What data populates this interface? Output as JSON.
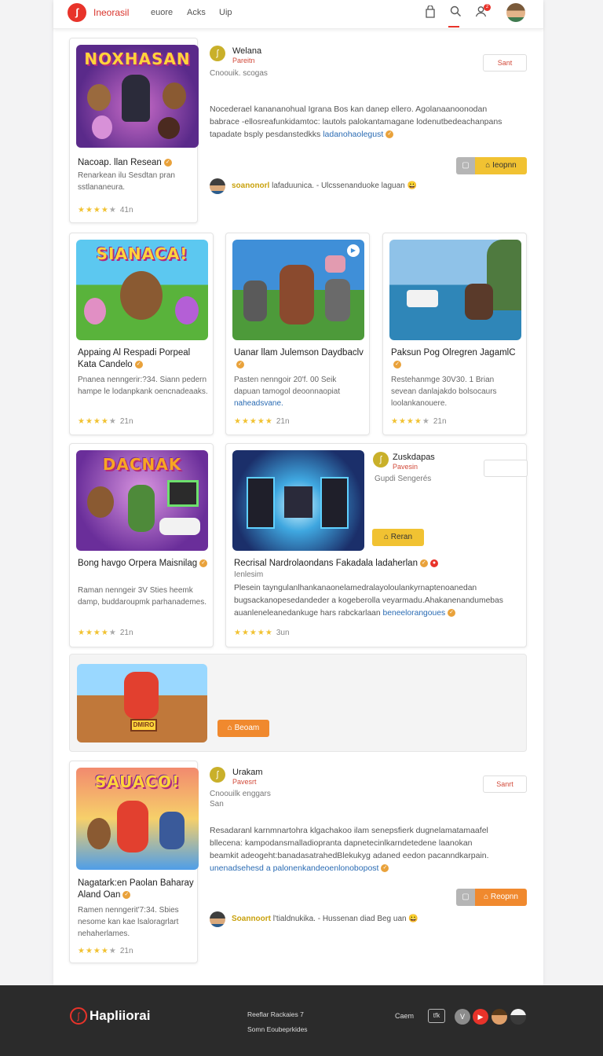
{
  "header": {
    "brand": "Ineorasil",
    "nav": [
      "euore",
      "Acks",
      "Uip"
    ],
    "notification_count": "2"
  },
  "featured": [
    {
      "thumb_text": "NOXHASAN",
      "title": "Nacoap. llan Resean",
      "desc": "Renarkean ilu Sesdtan pran sstlananeura.",
      "rating_count": "41n",
      "org_name": "Welana",
      "org_sub": "Pareitn",
      "org_meta": "Cnoouik. scogas",
      "org_meta2": "",
      "action": "Sant",
      "text_lines": [
        "Nocederael kanananohual Igrana Bos kan danep ellero. Agolanaanoonodan",
        "babrace -ellosreafunkidamtoc: lautols palokantamagane lodenutbedeachanpans",
        "tapadate bsply pesdanstedkks"
      ],
      "text_link": "ladanohaolegust",
      "cta": "Ieopnn",
      "user_name": "soanonorl",
      "user_text": "lafaduunica. - Ulcssenanduoke laguan"
    },
    {
      "thumb_text": "SAUACO!",
      "title": "Nagatark:en Paolan Baharay Aland Oan",
      "desc": "Ramen nenngerit'7:34. Sbies nesome kan kae lsaloragrlart nehaherlames.",
      "rating_count": "21n",
      "org_name": "Urakam",
      "org_sub": "Pavesrt",
      "org_meta": "Cnoouilk enggars",
      "org_meta2": "San",
      "action": "Sanrt",
      "text_lines": [
        "Resadaranl karnmnartohra klgachakoo ilam senepsfierk dugnelamatamaafel",
        "bllecena: kampodansmalladiopranta dapnetecinlkarndetedene laanokan",
        "beamkit adeogeht:banadasatrahedBlekukyg adaned eedon pacanndkarpain."
      ],
      "text_link": "unenadsehesd a palonenkandeoenlonobopost",
      "cta": "Reopnn",
      "user_name": "Soannoort",
      "user_text": "l'tialdnukika. - Hussenan diad Beg uan"
    }
  ],
  "grid": [
    {
      "thumb_text": "SIANACA!",
      "title": "Appaing Al Respadi Porpeal Kata Candelo",
      "desc": "Pnanea nenngerir:?34. Siann pedern hampe le lodanpkank oencnadeaaks.",
      "link": "",
      "rating_count": "21n"
    },
    {
      "thumb_text": "",
      "title": "Uanar llam Julemson Daydbaclv",
      "desc": "Pasten nenngoir 20'f. 00 Seik dapuan tamogol deoonnaopiat",
      "link": "naheadsvane.",
      "rating_count": "21n"
    },
    {
      "thumb_text": "",
      "title": "Paksun Pog Olregren JagamlC",
      "desc": "Restehanmge 30V30. 1 Brian sevean danlajakdo bolsocaurs loolankanouere.",
      "link": "",
      "rating_count": "21n"
    },
    {
      "thumb_text": "DACNAK",
      "title": "Bong havgo Orpera Maisnilag",
      "desc": "Raman nenngeir 3V Sties heemk damp, buddaroupmk parhanademes.",
      "link": "",
      "rating_count": "21n"
    }
  ],
  "wide": {
    "org_name": "Zuskdapas",
    "org_sub": "Pavesin",
    "org_meta": "Gupdi Sengerés",
    "cta": "Reran",
    "title": "Recrisal Nardrolaondans Fakadala ladaherlan",
    "subtitle": "Ienlesim",
    "text_lines": [
      "Plesein tayngulanlhankanaonelamedralayoloulankyrnaptenoanedan",
      "bugsackanopesedandeder a kogeberolla veyarmadu.Ahakanenandumebas",
      "auanleneleanedankuge hars rabckarlaan"
    ],
    "text_link": "beneelorangoues",
    "rating_count": "3un"
  },
  "promo": {
    "thumb_text": "DMIRO",
    "cta": "Beoam"
  },
  "footer": {
    "brand": "Hapliiorai",
    "line1": "Reeflar Rackaies 7",
    "line2": "Somn Eoubeprkides",
    "label": "Caem",
    "badge": "tfk"
  },
  "colors": {
    "accent": "#e8332a",
    "cta_yellow": "#f1c232",
    "cta_orange": "#f0892e",
    "link": "#2a6bb3",
    "star": "#f1c232"
  }
}
